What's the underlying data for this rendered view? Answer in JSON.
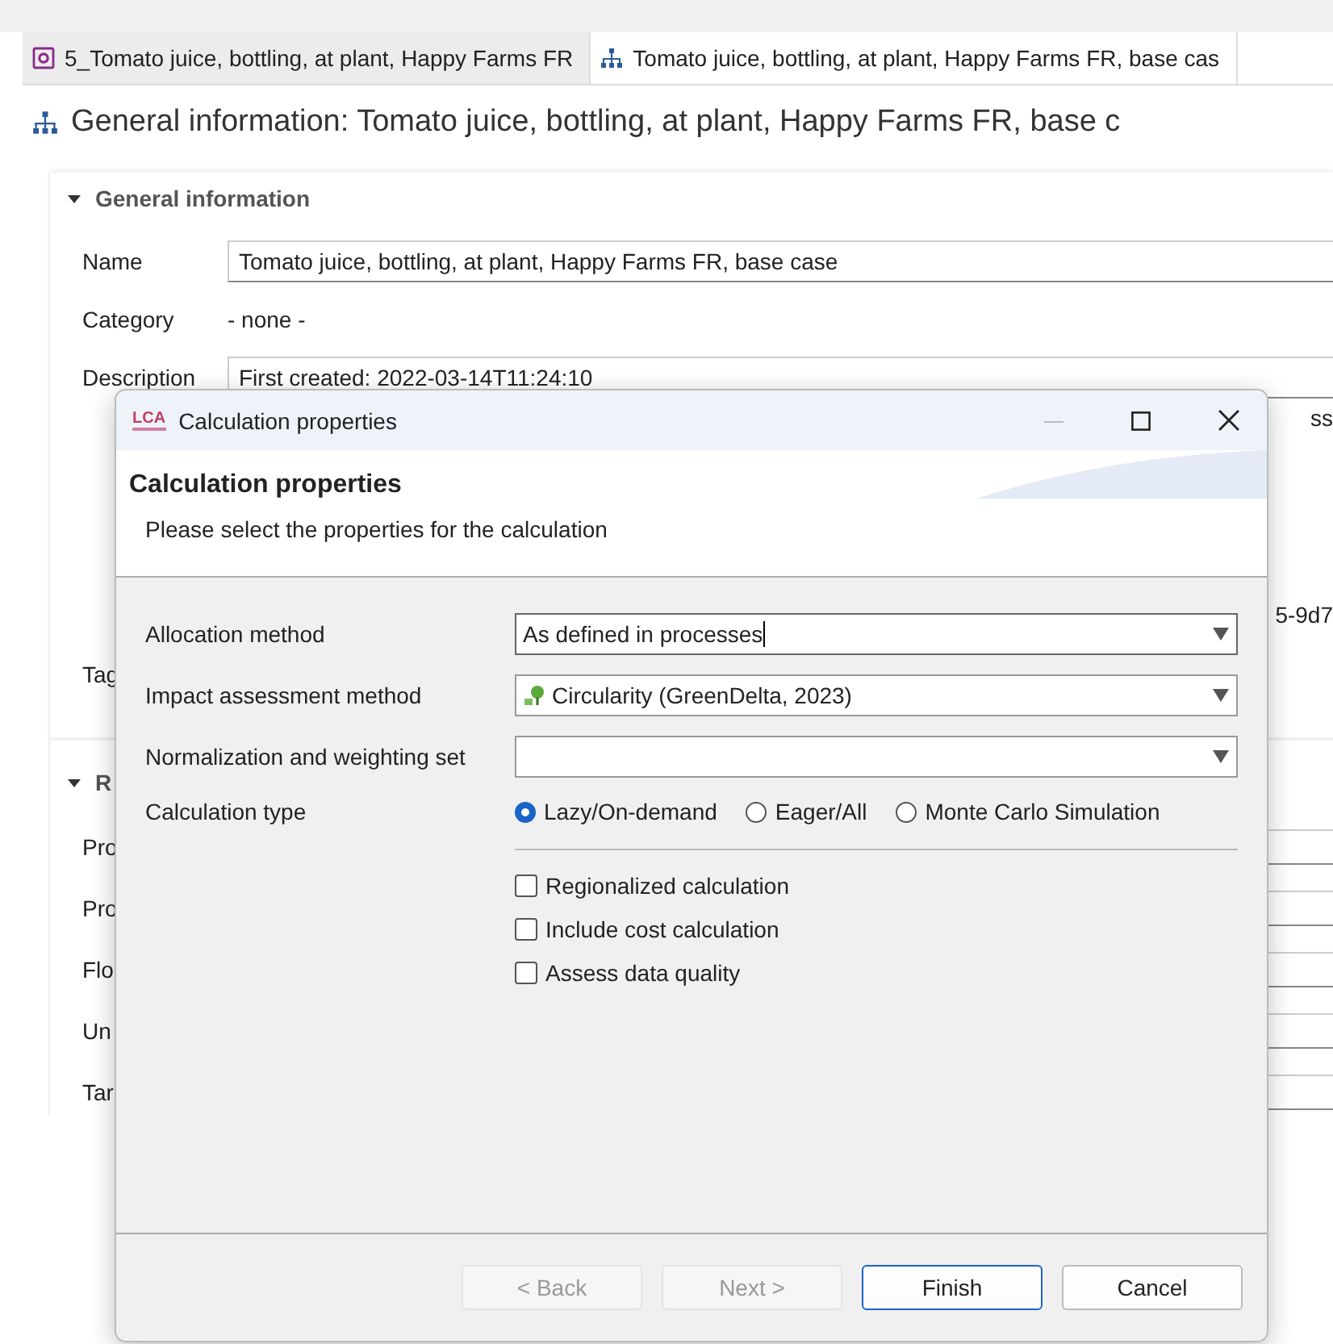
{
  "editor": {
    "tabs": [
      {
        "label": "5_Tomato juice, bottling, at plant, Happy Farms FR",
        "kind": "gear",
        "selected": false
      },
      {
        "label": "Tomato juice, bottling, at plant, Happy Farms FR, base cas",
        "kind": "hierarchy",
        "selected": true
      }
    ],
    "heading": "General information: Tomato juice, bottling, at plant, Happy Farms FR, base c",
    "sections": [
      {
        "title": "General information",
        "expanded": true,
        "rows": [
          {
            "label": "Name",
            "kind": "field",
            "value": "Tomato juice, bottling, at plant, Happy Farms FR, base case"
          },
          {
            "label": "Category",
            "kind": "text",
            "value": "- none -"
          },
          {
            "label": "Description",
            "kind": "field",
            "value": "First created: 2022-03-14T11:24:10"
          },
          {
            "kind": "peek",
            "value": "ss"
          },
          {
            "kind": "peek",
            "value": "5-9d7"
          },
          {
            "label": "Tag",
            "kind": "label"
          }
        ]
      },
      {
        "title": "R",
        "expanded": true,
        "rows": [
          {
            "label": "Pro",
            "kind": "stub"
          },
          {
            "label": "Pro",
            "kind": "stub"
          },
          {
            "label": "Flo",
            "kind": "stub"
          },
          {
            "label": "Un",
            "kind": "stub"
          },
          {
            "label": "Tar",
            "kind": "stub"
          }
        ]
      }
    ]
  },
  "dialog": {
    "window_title": "Calculation properties",
    "logo": "LCA",
    "heading": "Calculation properties",
    "description": "Please select the properties for the calculation",
    "fields": [
      {
        "label": "Allocation method",
        "value": "As defined in processes",
        "focused": true
      },
      {
        "label": "Impact assessment method",
        "value": "Circularity (GreenDelta, 2023)",
        "kind": "icon_value",
        "focused": false
      },
      {
        "label": "Normalization and weighting set",
        "focused": false
      }
    ],
    "calculation_type": {
      "label": "Calculation type",
      "options": [
        {
          "label": "Lazy/On-demand",
          "selected": true
        },
        {
          "label": "Eager/All",
          "selected": false
        },
        {
          "label": "Monte Carlo Simulation",
          "selected": false
        }
      ]
    },
    "checkboxes": [
      {
        "label": "Regionalized calculation",
        "checked": false
      },
      {
        "label": "Include cost calculation",
        "checked": false
      },
      {
        "label": "Assess data quality",
        "checked": false
      }
    ],
    "buttons": [
      {
        "label": "< Back",
        "disabled": true,
        "default": false
      },
      {
        "label": "Next >",
        "disabled": true,
        "default": false
      },
      {
        "label": "Finish",
        "disabled": false,
        "default": true
      },
      {
        "label": "Cancel",
        "disabled": false,
        "default": false
      }
    ]
  }
}
